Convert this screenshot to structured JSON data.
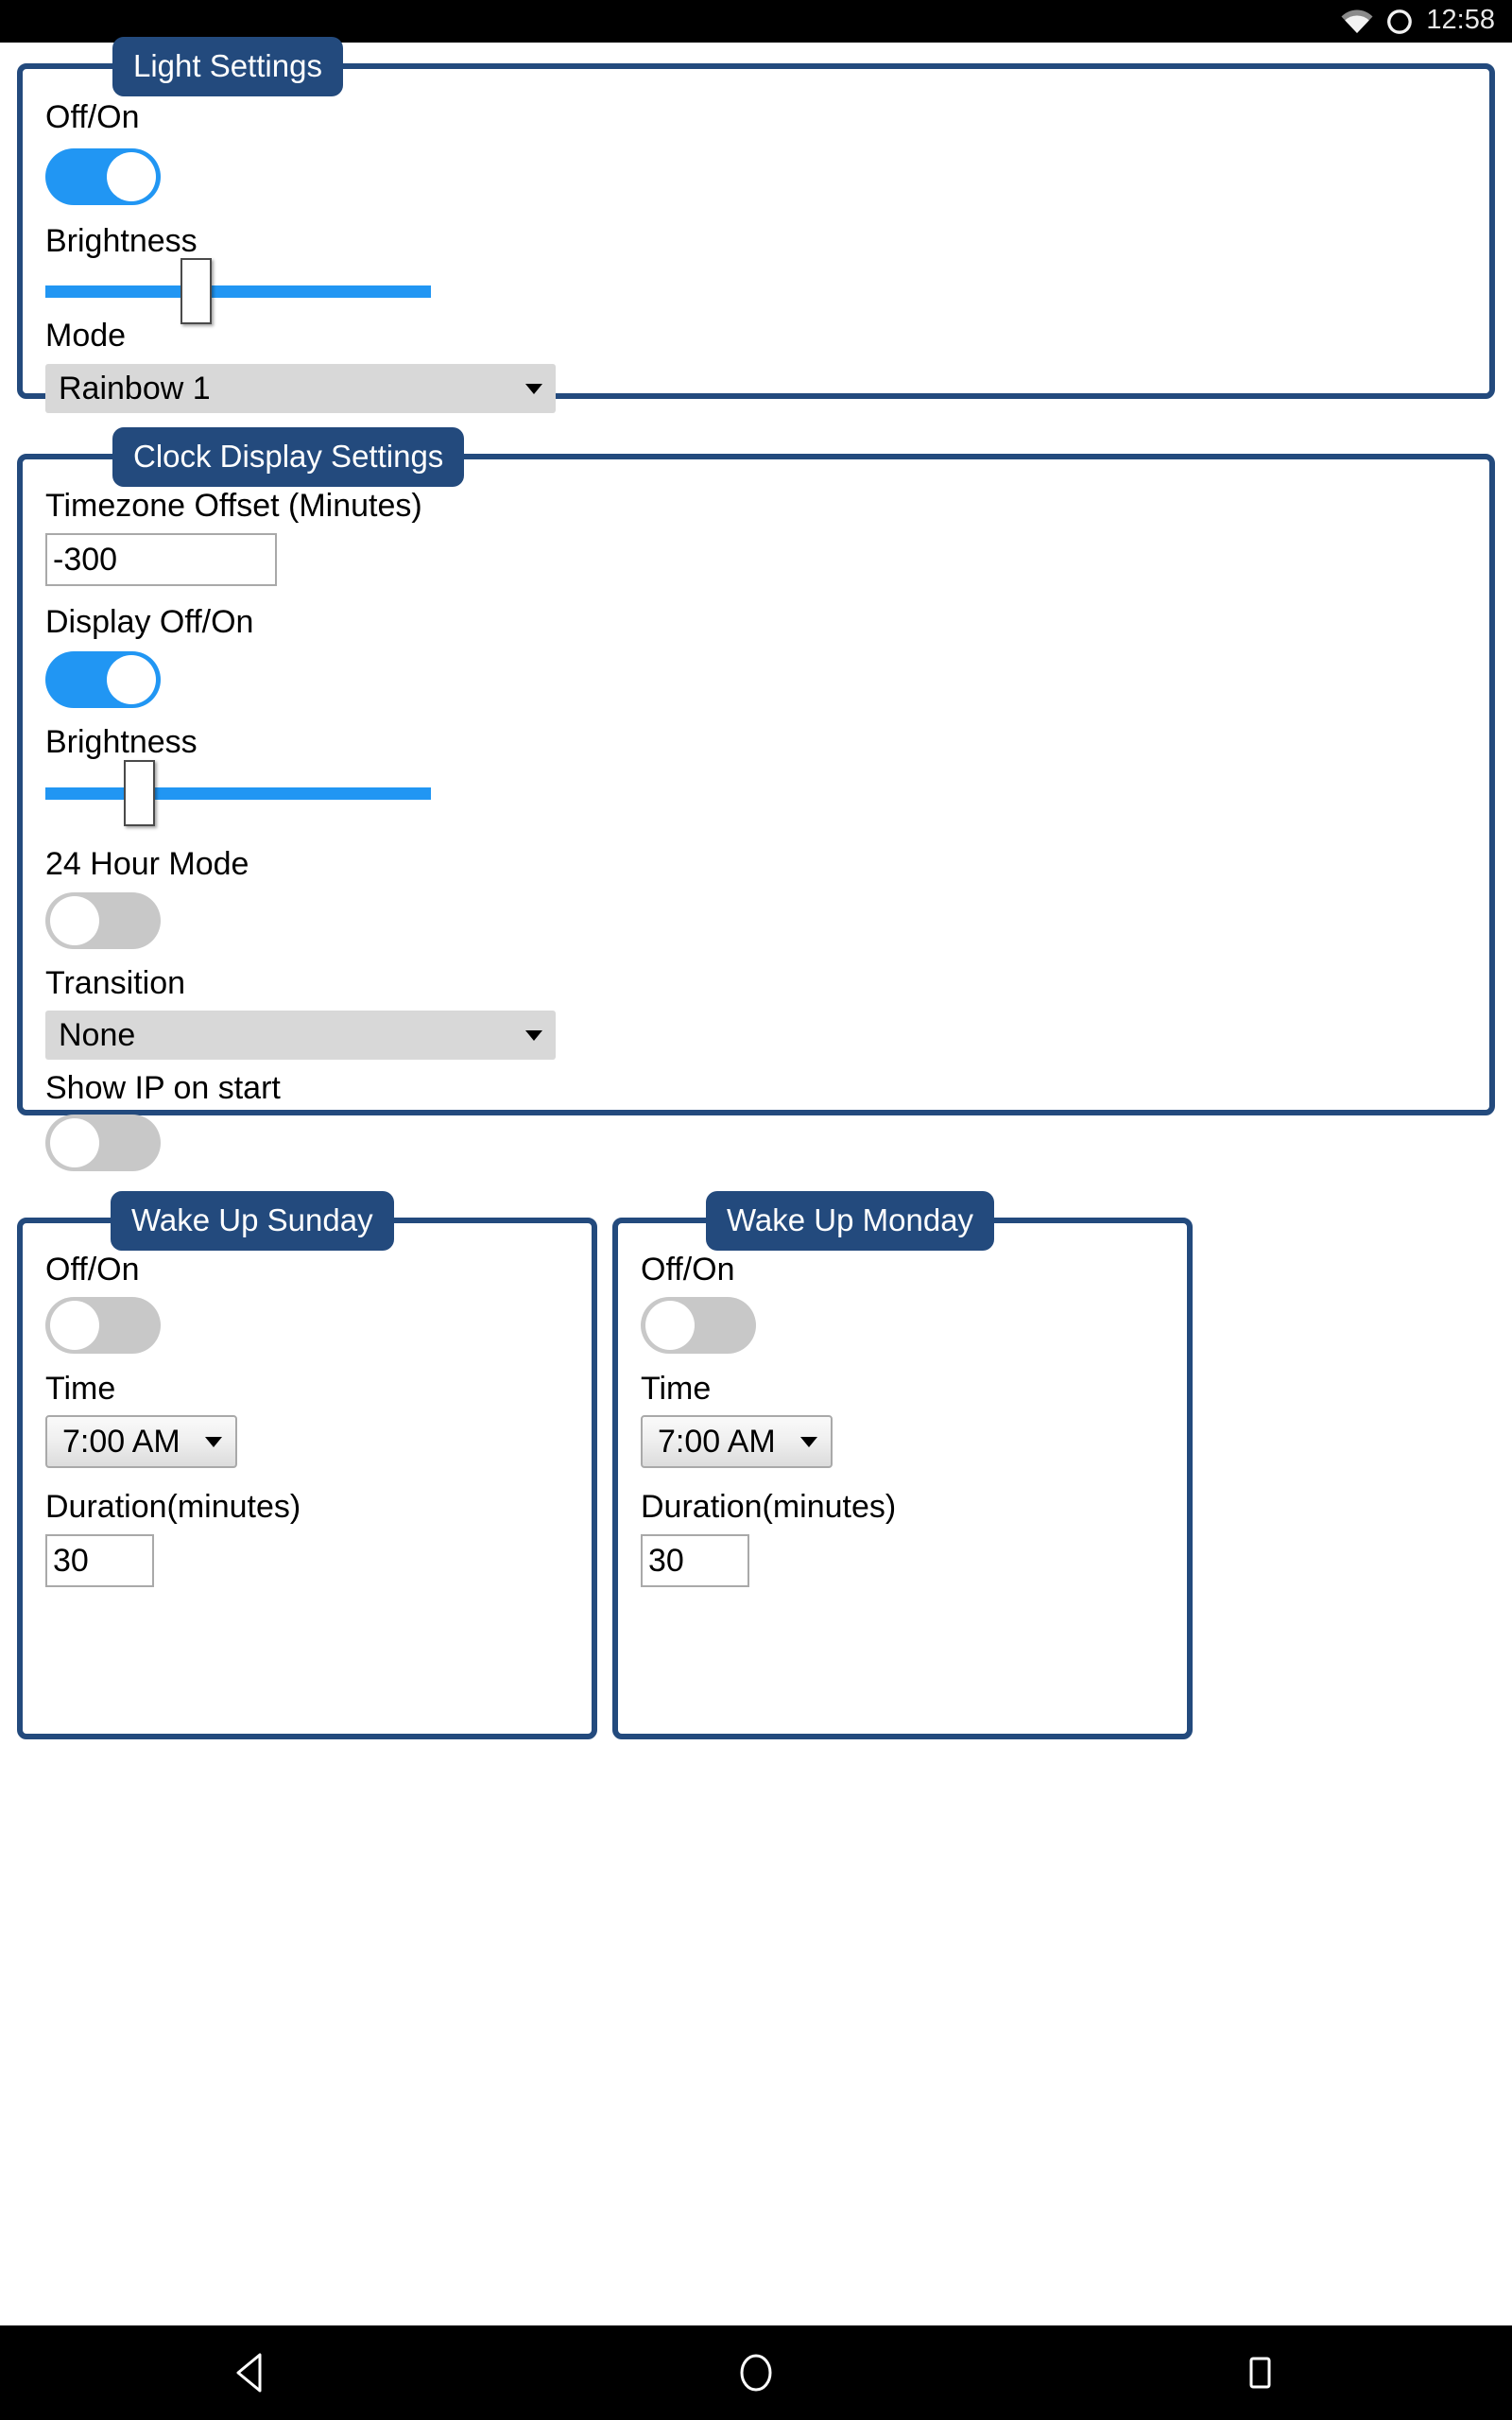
{
  "status_bar": {
    "wifi_icon": "wifi-icon",
    "sync_icon": "sync-circle-icon",
    "time": "12:58"
  },
  "colors": {
    "panel_border": "#234a7d",
    "legend_background": "#234a7d",
    "legend_text": "#ffffff",
    "toggle_on": "#2196f3",
    "toggle_off": "#c8c8c8",
    "slider_track": "#2196f3",
    "select_flat_background": "#d8d8d8",
    "status_bar_background": "#000000",
    "nav_bar_background": "#000000",
    "page_background": "#ffffff"
  },
  "panels": {
    "light_settings": {
      "legend": "Light Settings",
      "on_off": {
        "label": "Off/On",
        "state": "on"
      },
      "brightness": {
        "label": "Brightness",
        "value": 38
      },
      "mode": {
        "label": "Mode",
        "value": "Rainbow 1"
      }
    },
    "clock_display_settings": {
      "legend": "Clock Display Settings",
      "timezone_offset": {
        "label": "Timezone Offset (Minutes)",
        "value": "-300"
      },
      "display_on_off": {
        "label": "Display Off/On",
        "state": "on"
      },
      "brightness": {
        "label": "Brightness",
        "value": 22
      },
      "hour_mode_24": {
        "label": "24 Hour Mode",
        "state": "off"
      },
      "transition": {
        "label": "Transition",
        "value": "None"
      },
      "show_ip_on_start": {
        "label": "Show IP on start",
        "state": "off"
      }
    },
    "wake_up_sunday": {
      "legend": "Wake Up Sunday",
      "on_off": {
        "label": "Off/On",
        "state": "off"
      },
      "time": {
        "label": "Time",
        "value": "7:00 AM"
      },
      "duration": {
        "label": "Duration(minutes)",
        "value": "30"
      }
    },
    "wake_up_monday": {
      "legend": "Wake Up Monday",
      "on_off": {
        "label": "Off/On",
        "state": "off"
      },
      "time": {
        "label": "Time",
        "value": "7:00 AM"
      },
      "duration": {
        "label": "Duration(minutes)",
        "value": "30"
      }
    }
  },
  "nav_bar": {
    "back": "back-triangle-icon",
    "home": "home-circle-icon",
    "recents": "recents-square-icon"
  }
}
